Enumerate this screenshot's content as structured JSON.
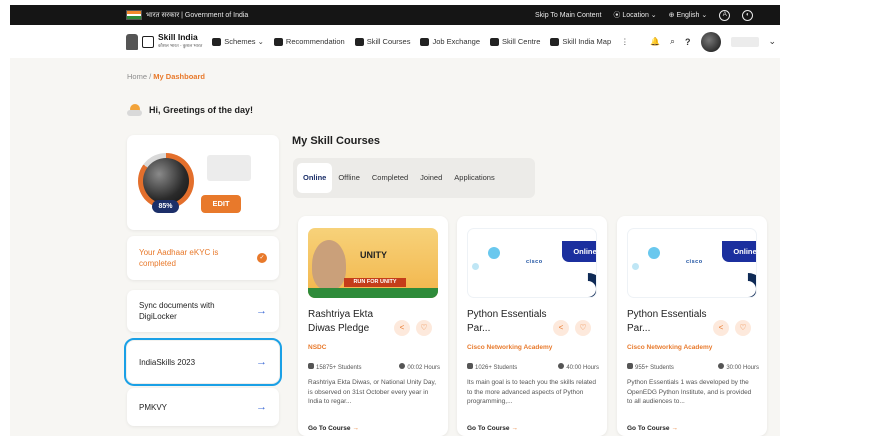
{
  "topbar": {
    "gov_text": "भारत सरकार | Government of India",
    "skip": "Skip To Main Content",
    "location": "Location ⌄",
    "language": "English ⌄",
    "a_icon": "A",
    "contrast_icon": "◐"
  },
  "nav": {
    "brand": "Skill India",
    "brand_sub": "कौशल भारत - कुशल भारत",
    "items": [
      {
        "label": "Schemes ⌄",
        "icon": "schemes-icon"
      },
      {
        "label": "Recommendation",
        "icon": "recommendation-icon"
      },
      {
        "label": "Skill Courses",
        "icon": "skill-courses-icon"
      },
      {
        "label": "Job Exchange",
        "icon": "job-exchange-icon"
      },
      {
        "label": "Skill Centre",
        "icon": "skill-centre-icon"
      },
      {
        "label": "Skill India Map",
        "icon": "map-icon"
      }
    ],
    "more": "⋮",
    "bell": "🔔",
    "search": "⌕",
    "help": "?",
    "chevron": "⌄"
  },
  "breadcrumb": {
    "home": "Home",
    "sep": "/",
    "current": "My Dashboard"
  },
  "greeting": "Hi, Greetings of the day!",
  "profile": {
    "percent": "85%",
    "edit_label": "EDIT"
  },
  "sidebar": {
    "aadhaar": "Your Aadhaar eKYC is completed",
    "aadhaar_check": "✓",
    "digilocker": "Sync documents with DigiLocker",
    "indiaskills": "IndiaSkills 2023",
    "pmkvy": "PMKVY",
    "arrow": "→"
  },
  "courses_section": {
    "title": "My Skill Courses",
    "tabs": [
      "Online",
      "Offline",
      "Completed",
      "Joined",
      "Applications"
    ],
    "active_tab": "Online"
  },
  "courses": [
    {
      "title": "Rashtriya Ekta Diwas Pledge",
      "org": "NSDC",
      "students": "15875+ Students",
      "hours": "00:02 Hours",
      "description": "Rashtriya Ekta Diwas, or National Unity Day, is observed on 31st October every year in India to regar...",
      "go": "Go To Course",
      "thumb_logo": "UNITY",
      "thumb_band": "RUN FOR UNITY"
    },
    {
      "title": "Python Essentials Par...",
      "org": "Cisco Networking Academy",
      "students": "1026+ Students",
      "hours": "40:00 Hours",
      "description": "Its main goal is to teach you the skills related to the more advanced aspects of Python programming,...",
      "go": "Go To Course",
      "badge": "Online",
      "thumb_logo": "cisco"
    },
    {
      "title": "Python Essentials Par...",
      "org": "Cisco Networking Academy",
      "students": "955+ Students",
      "hours": "30:00 Hours",
      "description": "Python Essentials 1 was developed by the OpenEDG Python Institute, and is provided to all audiences to...",
      "go": "Go To Course",
      "badge": "Online",
      "thumb_logo": "cisco"
    }
  ],
  "colors": {
    "accent": "#e8792b",
    "navy": "#1c2f69",
    "badge": "#1b2f9e",
    "highlight": "#1aa0e6"
  }
}
